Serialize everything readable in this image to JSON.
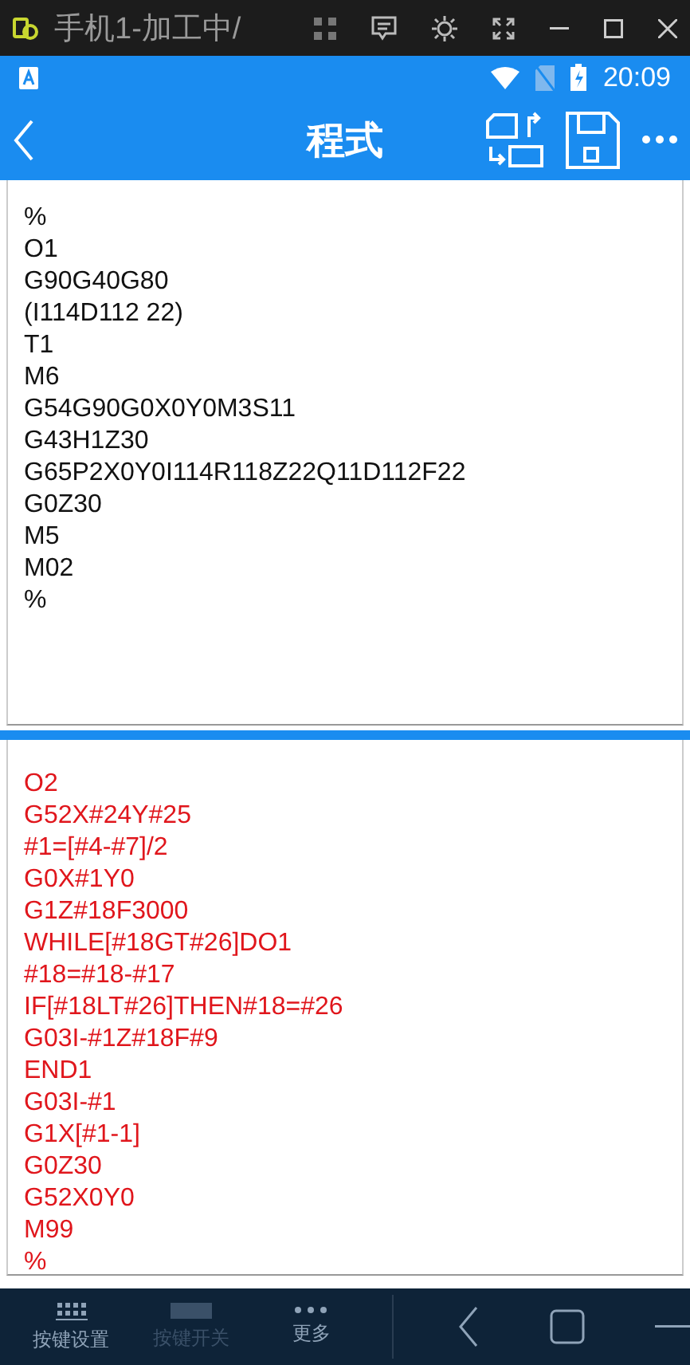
{
  "window": {
    "title": "手机1-加工中/"
  },
  "status_bar": {
    "time": "20:09"
  },
  "app_bar": {
    "title": "程式"
  },
  "main_program": {
    "lines": [
      "%",
      "O1",
      "G90G40G80",
      "(I114D112 22)",
      "T1",
      "M6",
      "G54G90G0X0Y0M3S11",
      "G43H1Z30",
      "G65P2X0Y0I114R118Z22Q11D112F22",
      "G0Z30",
      "M5",
      "M02",
      "%"
    ]
  },
  "macro_program": {
    "lines": [
      "O2",
      "G52X#24Y#25",
      "#1=[#4-#7]/2",
      "G0X#1Y0",
      "G1Z#18F3000",
      "WHILE[#18GT#26]DO1",
      "#18=#18-#17",
      "IF[#18LT#26]THEN#18=#26",
      "G03I-#1Z#18F#9",
      "END1",
      "G03I-#1",
      "G1X[#1-1]",
      "G0Z30",
      "G52X0Y0",
      "M99",
      "%"
    ]
  },
  "bottom_bar": {
    "items": [
      {
        "kind": "keys",
        "label": "按键设置",
        "disabled": false
      },
      {
        "kind": "toggle",
        "label": "按键开关",
        "disabled": true
      },
      {
        "kind": "more",
        "label": "更多",
        "disabled": false
      }
    ]
  }
}
